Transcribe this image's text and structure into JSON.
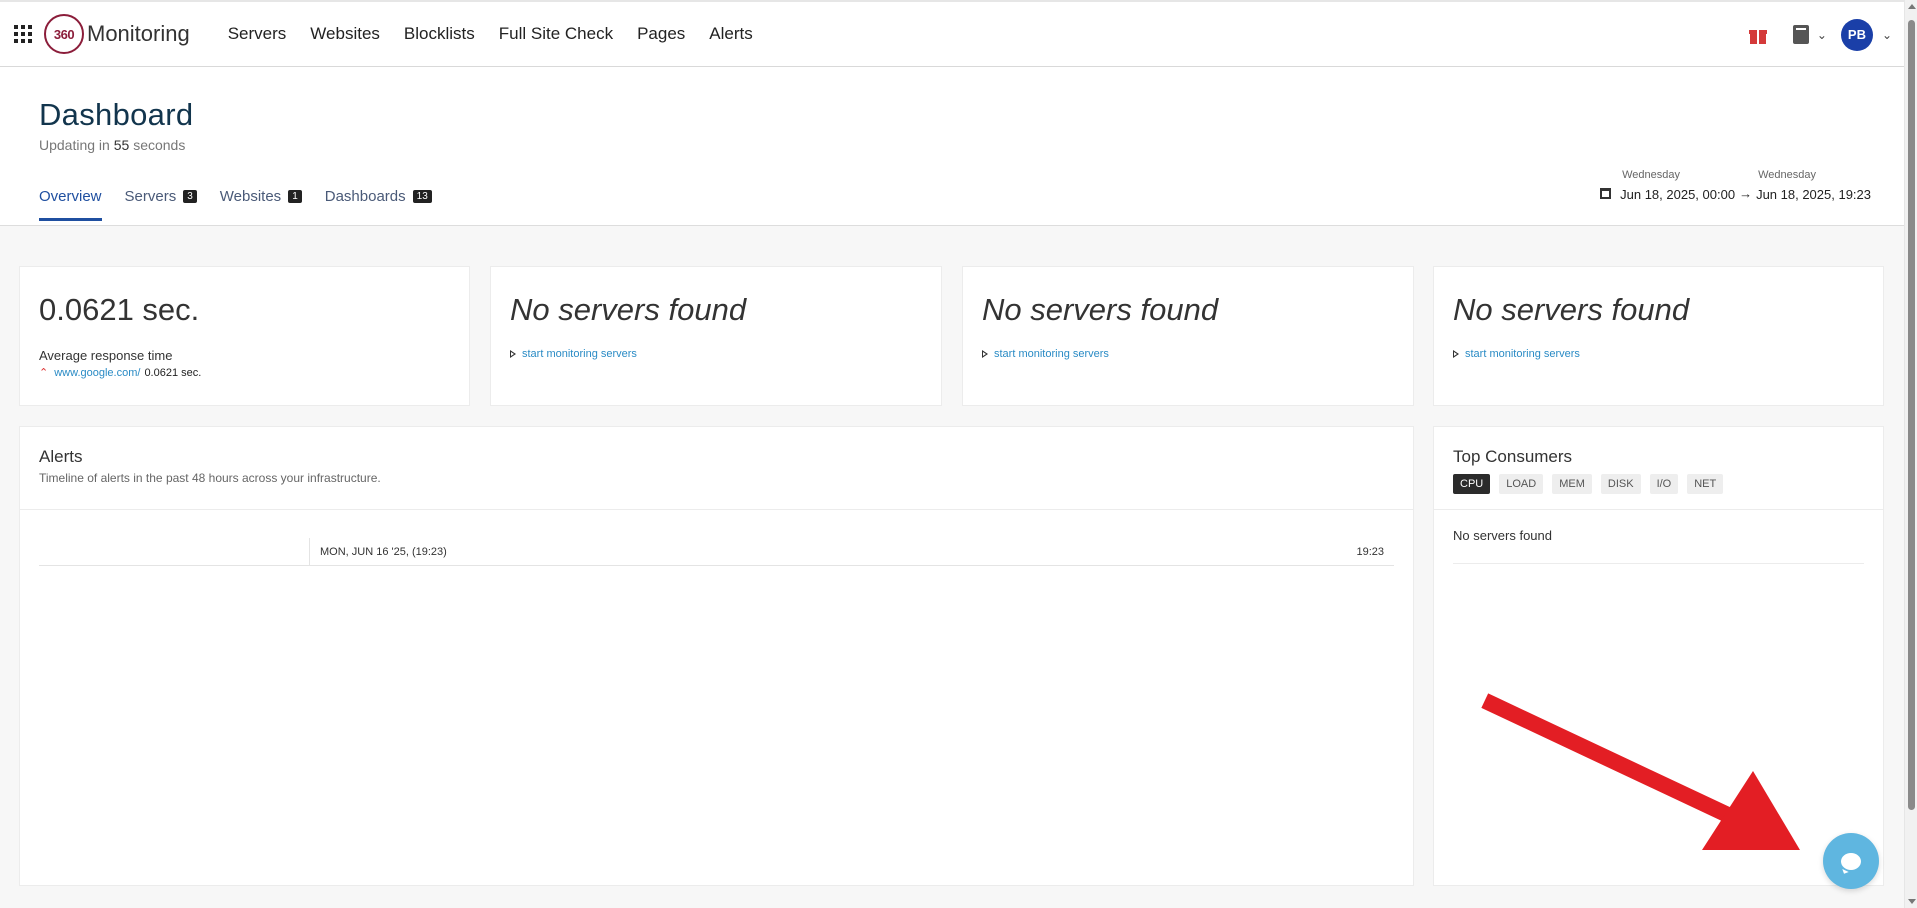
{
  "nav": {
    "logo_mark": "360",
    "logo_text": "Monitoring",
    "items": [
      "Servers",
      "Websites",
      "Blocklists",
      "Full Site Check",
      "Pages",
      "Alerts"
    ],
    "avatar_initials": "PB"
  },
  "header": {
    "title": "Dashboard",
    "updating_prefix": "Updating in",
    "updating_count": "55",
    "updating_suffix": "seconds",
    "tabs": [
      {
        "label": "Overview",
        "badge": ""
      },
      {
        "label": "Servers",
        "badge": "3"
      },
      {
        "label": "Websites",
        "badge": "1"
      },
      {
        "label": "Dashboards",
        "badge": "13"
      }
    ],
    "range": {
      "start_day": "Wednesday",
      "start": "Jun 18, 2025, 00:00",
      "end_day": "Wednesday",
      "end": "Jun 18, 2025, 19:23"
    }
  },
  "cards": {
    "response": {
      "value": "0.0621 sec.",
      "label": "Average response time",
      "site": "www.google.com/",
      "site_value": "0.0621 sec."
    },
    "empty_title": "No servers found",
    "empty_link": "start monitoring servers"
  },
  "alerts": {
    "title": "Alerts",
    "description": "Timeline of alerts in the past 48 hours across your infrastructure.",
    "timeline_start": "MON, JUN 16 '25, (19:23)",
    "timeline_end": "19:23"
  },
  "consumers": {
    "title": "Top Consumers",
    "chips": [
      "CPU",
      "LOAD",
      "MEM",
      "DISK",
      "I/O",
      "NET"
    ],
    "empty": "No servers found"
  },
  "colors": {
    "accent": "#1f4fa0",
    "link": "#2a8bc5",
    "avatar": "#1a3fa8",
    "chat": "#5fb6e0",
    "annotation": "#e31e24"
  }
}
